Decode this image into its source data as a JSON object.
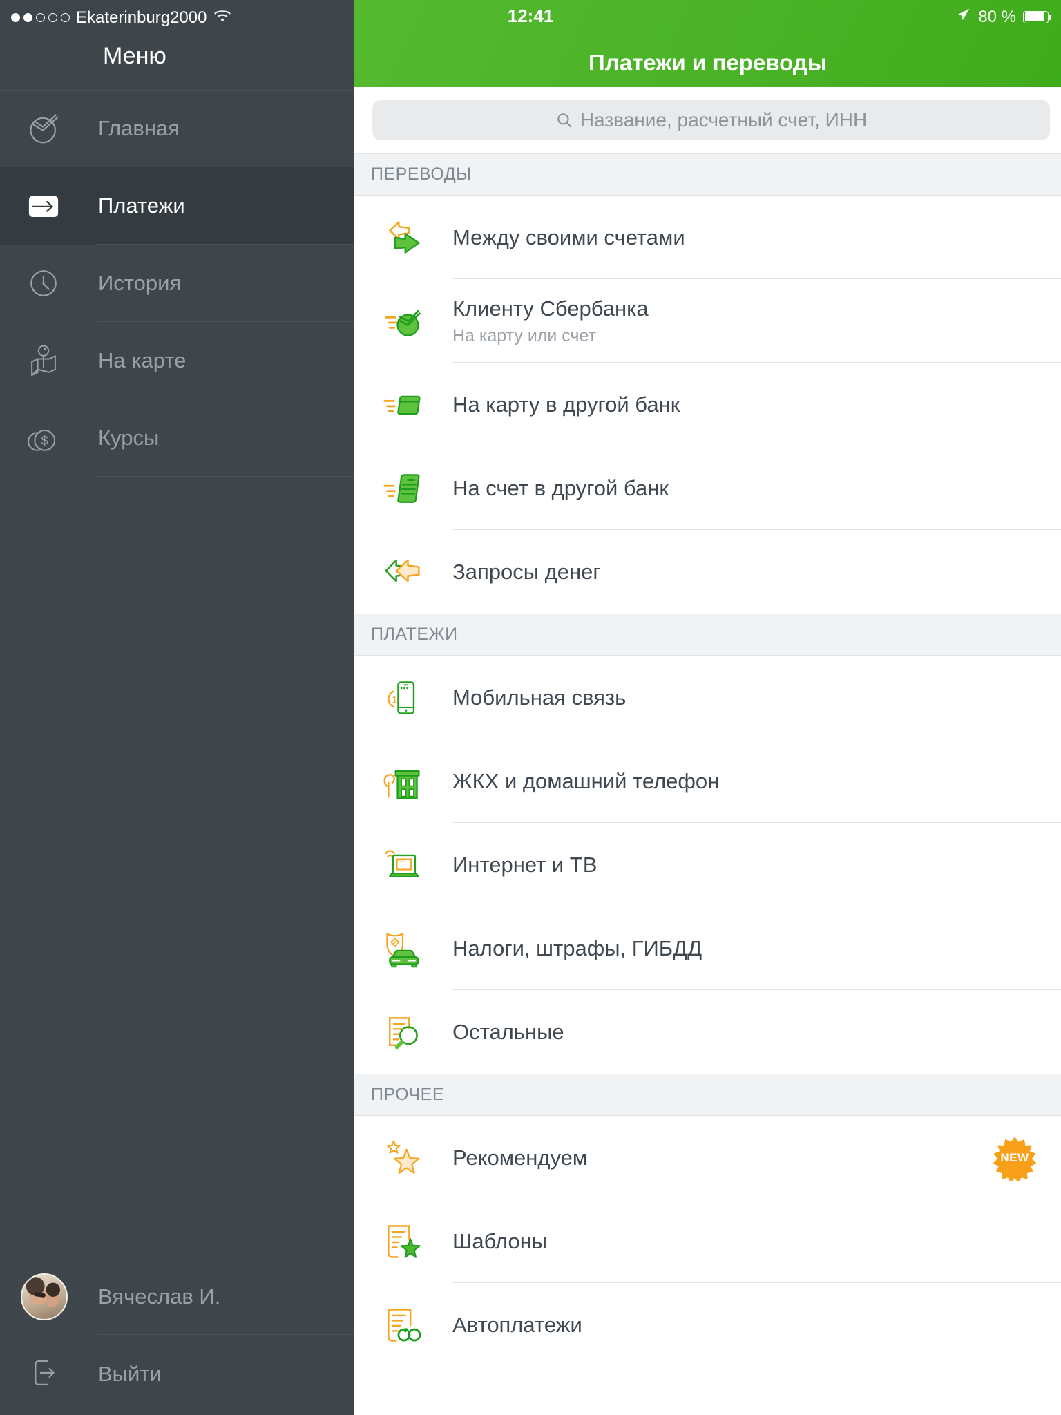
{
  "status_bar": {
    "carrier": "Ekaterinburg2000",
    "signal": "2 of 5 dots",
    "time": "12:41",
    "battery_percent": "80 %"
  },
  "sidebar": {
    "title": "Меню",
    "items": [
      {
        "label": "Главная",
        "icon": "sberbank-logo",
        "active": false
      },
      {
        "label": "Платежи",
        "icon": "card-arrow",
        "active": true
      },
      {
        "label": "История",
        "icon": "clock",
        "active": false
      },
      {
        "label": "На карте",
        "icon": "map-pin",
        "active": false
      },
      {
        "label": "Курсы",
        "icon": "coins",
        "active": false
      }
    ],
    "profile_name": "Вячеслав И.",
    "logout_label": "Выйти"
  },
  "header": {
    "title": "Платежи и переводы"
  },
  "search": {
    "placeholder": "Название, расчетный счет, ИНН"
  },
  "sections": [
    {
      "header": "ПЕРЕВОДЫ",
      "rows": [
        {
          "title": "Между своими счетами"
        },
        {
          "title": "Клиенту Сбербанка",
          "subtitle": "На карту или счет"
        },
        {
          "title": "На карту в другой банк"
        },
        {
          "title": "На счет в другой банк"
        },
        {
          "title": "Запросы денег"
        }
      ]
    },
    {
      "header": "ПЛАТЕЖИ",
      "rows": [
        {
          "title": "Мобильная связь"
        },
        {
          "title": "ЖКХ и домашний телефон"
        },
        {
          "title": "Интернет и ТВ"
        },
        {
          "title": "Налоги, штрафы, ГИБДД"
        },
        {
          "title": "Остальные"
        }
      ]
    },
    {
      "header": "ПРОЧЕЕ",
      "rows": [
        {
          "title": "Рекомендуем",
          "badge": "NEW"
        },
        {
          "title": "Шаблоны"
        },
        {
          "title": "Автоплатежи"
        }
      ]
    }
  ],
  "colors": {
    "header_green": "#4AB226",
    "icon_green": "#2FA622",
    "icon_green_fill": "#5EC23C",
    "icon_orange": "#F7A41F",
    "badge_orange": "#F9A01B",
    "sidebar_bg": "#3E464B",
    "sidebar_active_bg": "#343B41",
    "section_band_bg": "#F1F2F4"
  }
}
